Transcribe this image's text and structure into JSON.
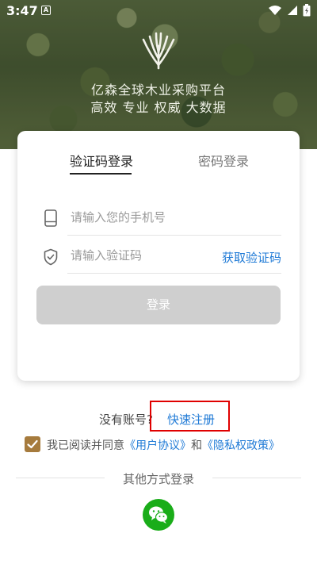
{
  "status_bar": {
    "time": "3:47",
    "notification_glyph": "A"
  },
  "hero": {
    "title_line1": "亿森全球木业采购平台",
    "title_line2": "高效  专业  权威  大数据"
  },
  "login_tabs": {
    "sms": "验证码登录",
    "password": "密码登录",
    "active": "sms"
  },
  "phone_field": {
    "placeholder": "请输入您的手机号",
    "value": ""
  },
  "code_field": {
    "placeholder": "请输入验证码",
    "value": ""
  },
  "get_code_label": "获取验证码",
  "login_button": "登录",
  "register": {
    "prompt": "没有账号?",
    "link": "快速注册"
  },
  "agreement": {
    "checked": true,
    "prefix": "我已阅读并同意",
    "user_agreement": "《用户协议》",
    "and": "和",
    "privacy_policy": "《隐私权政策》"
  },
  "other_login_label": "其他方式登录",
  "colors": {
    "accent_blue": "#1f7ad6",
    "checkbox_brown": "#a67b3d",
    "wechat_green": "#1aad19",
    "highlight_red": "#e00000",
    "disabled_button": "#cfcfcf"
  },
  "icons": [
    "wifi-icon",
    "signal-icon",
    "battery-icon",
    "phone-icon",
    "shield-icon",
    "check-icon",
    "wechat-icon",
    "tree-logo-icon"
  ]
}
